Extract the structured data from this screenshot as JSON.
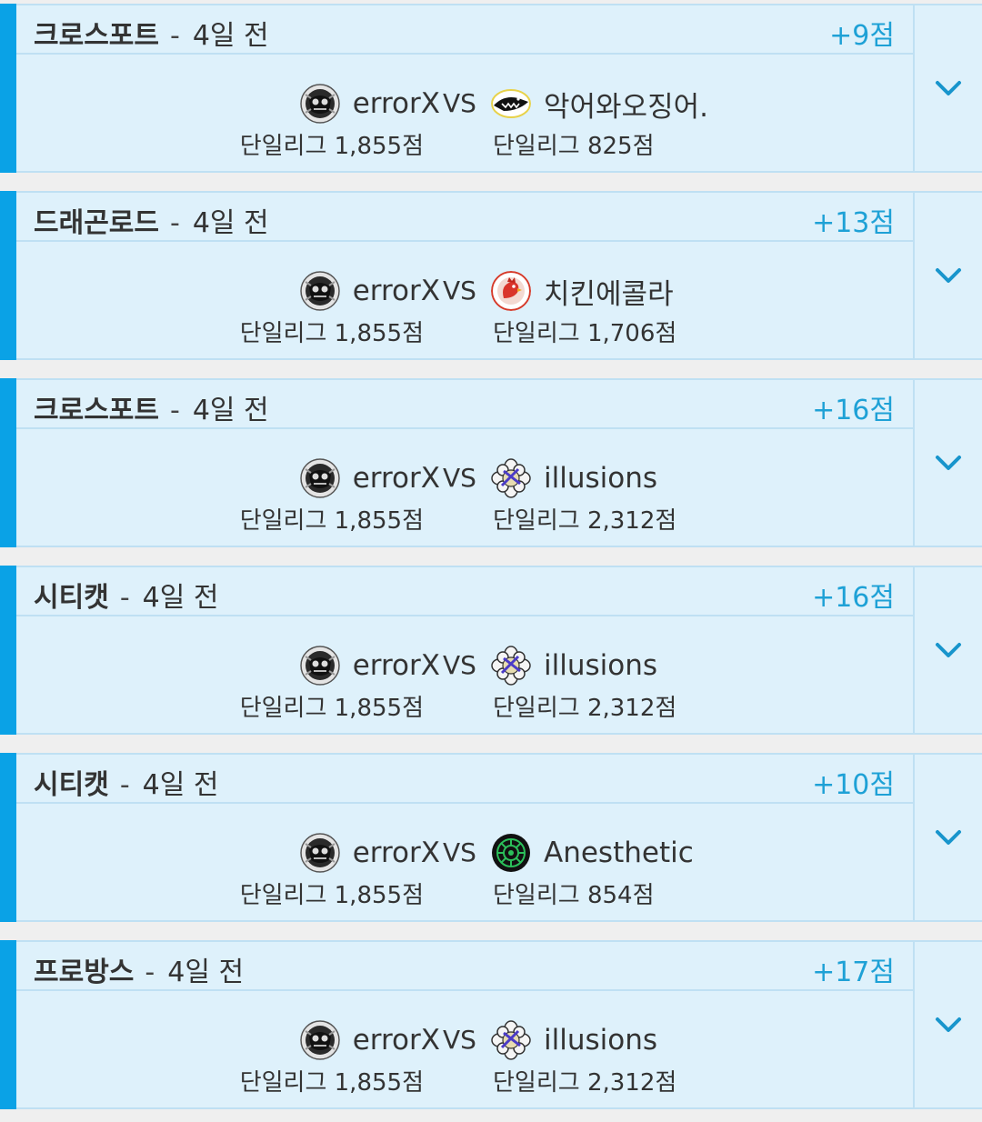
{
  "matches": [
    {
      "map": "크로스포트",
      "separator": "-",
      "ago": "4일 전",
      "points": "+9점",
      "player1": {
        "name": "errorX",
        "avatar": "skull-emblem-icon",
        "rating": "단일리그 1,855점"
      },
      "vs": "VS",
      "player2": {
        "name": "악어와오징어.",
        "avatar": "crocodile-emblem-icon",
        "rating": "단일리그 825점"
      }
    },
    {
      "map": "드래곤로드",
      "separator": "-",
      "ago": "4일 전",
      "points": "+13점",
      "player1": {
        "name": "errorX",
        "avatar": "skull-emblem-icon",
        "rating": "단일리그 1,855점"
      },
      "vs": "VS",
      "player2": {
        "name": "치킨에콜라",
        "avatar": "rooster-emblem-icon",
        "rating": "단일리그 1,706점"
      }
    },
    {
      "map": "크로스포트",
      "separator": "-",
      "ago": "4일 전",
      "points": "+16점",
      "player1": {
        "name": "errorX",
        "avatar": "skull-emblem-icon",
        "rating": "단일리그 1,855점"
      },
      "vs": "VS",
      "player2": {
        "name": "illusions",
        "avatar": "flower-emblem-icon",
        "rating": "단일리그 2,312점"
      }
    },
    {
      "map": "시티캣",
      "separator": "-",
      "ago": "4일 전",
      "points": "+16점",
      "player1": {
        "name": "errorX",
        "avatar": "skull-emblem-icon",
        "rating": "단일리그 1,855점"
      },
      "vs": "VS",
      "player2": {
        "name": "illusions",
        "avatar": "flower-emblem-icon",
        "rating": "단일리그 2,312점"
      }
    },
    {
      "map": "시티캣",
      "separator": "-",
      "ago": "4일 전",
      "points": "+10점",
      "player1": {
        "name": "errorX",
        "avatar": "skull-emblem-icon",
        "rating": "단일리그 1,855점"
      },
      "vs": "VS",
      "player2": {
        "name": "Anesthetic",
        "avatar": "green-gear-emblem-icon",
        "rating": "단일리그 854점"
      }
    },
    {
      "map": "프로방스",
      "separator": "-",
      "ago": "4일 전",
      "points": "+17점",
      "player1": {
        "name": "errorX",
        "avatar": "skull-emblem-icon",
        "rating": "단일리그 1,855점"
      },
      "vs": "VS",
      "player2": {
        "name": "illusions",
        "avatar": "flower-emblem-icon",
        "rating": "단일리그 2,312점"
      }
    }
  ],
  "colors": {
    "accent": "#0aa2e6",
    "card_bg": "#def1fb",
    "points": "#1ea1d6",
    "chevron": "#1895cc",
    "page_bg": "#efefef"
  }
}
